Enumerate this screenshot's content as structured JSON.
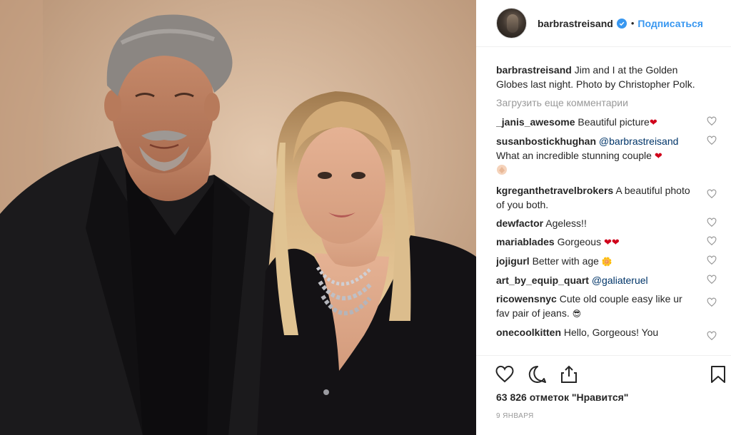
{
  "post": {
    "image_alt": "Photo of two people at an event",
    "author": "barbrastreisand",
    "verified": true,
    "separator": "•",
    "follow_label": "Подписаться"
  },
  "caption": {
    "user": "barbrastreisand",
    "text": "Jim and I at the Golden Globes last night. Photo by Christopher Polk."
  },
  "load_more_label": "Загрузить еще комментарии",
  "comments": [
    {
      "user": "_janis_awesome",
      "text": "Beautiful picture",
      "suffix": "❤"
    },
    {
      "user": "susanbostickhughan",
      "mention": "@barbrastreisand",
      "text": "What an incredible stunning couple",
      "suffix": "❤"
    },
    {
      "user": "kgreganthetravelbrokers",
      "text": "A beautiful photo of you both.",
      "suffix": ""
    },
    {
      "user": "dewfactor",
      "text": "Ageless!!",
      "suffix": ""
    },
    {
      "user": "mariablades",
      "text": "Gorgeous",
      "suffix": "❤❤"
    },
    {
      "user": "jojigurl",
      "text": "Better with age",
      "suffix": "🌼"
    },
    {
      "user": "art_by_equip_quart",
      "mention": "@galiateruel",
      "text": "",
      "suffix": ""
    },
    {
      "user": "ricowensnyc",
      "text": "Cute old couple easy like ur fav pair of jeans.",
      "suffix": "😎"
    },
    {
      "user": "onecoolkitten",
      "text": "Hello, Gorgeous! You",
      "suffix": ""
    }
  ],
  "icons": {
    "like": "heart-outline-icon",
    "comment": "speech-bubble-icon",
    "share": "share-arrow-icon",
    "save": "bookmark-icon",
    "comment_like": "small-heart-icon",
    "verified": "verified-check-icon"
  },
  "likes_text": "63 826 отметок \"Нравится\"",
  "date_text": "9 января",
  "colors": {
    "link_blue": "#3897f0",
    "mention_blue": "#003569",
    "heart_red": "#d0021b",
    "muted_gray": "#999999"
  }
}
